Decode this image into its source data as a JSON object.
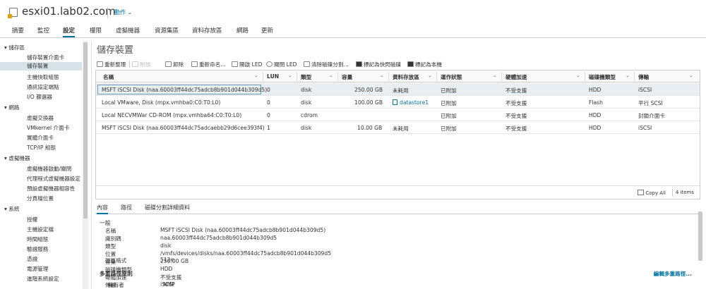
{
  "header": {
    "host": "esxi01.lab02.com",
    "actions": "動作 ⌄"
  },
  "tabs": [
    "摘要",
    "監控",
    "設定",
    "權限",
    "虛擬機器",
    "資源集區",
    "資料存放區",
    "網路",
    "更新"
  ],
  "sidebar": [
    {
      "label": "▾ 儲存區",
      "kind": "group"
    },
    {
      "label": "儲存裝置介面卡",
      "kind": "item"
    },
    {
      "label": "儲存裝置",
      "kind": "item",
      "selected": true
    },
    {
      "label": "主機快取組態",
      "kind": "item"
    },
    {
      "label": "通訊協定端點",
      "kind": "item"
    },
    {
      "label": "I/O 篩選器",
      "kind": "item"
    },
    {
      "label": "▾ 網路",
      "kind": "group"
    },
    {
      "label": "虛擬交換器",
      "kind": "item"
    },
    {
      "label": "VMkernel 介面卡",
      "kind": "item"
    },
    {
      "label": "實體介面卡",
      "kind": "item"
    },
    {
      "label": "TCP/IP 組態",
      "kind": "item"
    },
    {
      "label": "▾ 虛擬機器",
      "kind": "group"
    },
    {
      "label": "虛擬機器啟動/關閉",
      "kind": "item"
    },
    {
      "label": "代理程式虛擬機器設定",
      "kind": "item"
    },
    {
      "label": "預設虛擬機器相容性",
      "kind": "item"
    },
    {
      "label": "分頁檔位置",
      "kind": "item"
    },
    {
      "label": "▾ 系統",
      "kind": "group"
    },
    {
      "label": "授權",
      "kind": "item"
    },
    {
      "label": "主機設定檔",
      "kind": "item"
    },
    {
      "label": "時間組態",
      "kind": "item"
    },
    {
      "label": "驗證服務",
      "kind": "item"
    },
    {
      "label": "憑證",
      "kind": "item"
    },
    {
      "label": "電源管理",
      "kind": "item"
    },
    {
      "label": "進階系統設定",
      "kind": "item"
    }
  ],
  "page_title": "儲存裝置",
  "toolbar": {
    "refresh": "重新整理",
    "attach": "附加",
    "detach": "卸除",
    "rename": "重新命名...",
    "led_on": "開啟 LED",
    "led_off": "關閉 LED",
    "erase": "清除磁碟分割...",
    "mark_flash": "標記為快閃磁碟",
    "mark_local": "標記為本機"
  },
  "columns": [
    "名稱",
    "LUN",
    "類型",
    "容量",
    "資料存放區",
    "運作狀態",
    "硬體加速",
    "磁碟機類型",
    "傳輸"
  ],
  "rows": [
    {
      "name": "MSFT iSCSI Disk (naa.60003ff44dc75adcb8b901d044b309d5)",
      "lun": "0",
      "type": "disk",
      "capacity": "250.00 GB",
      "datastore": "未耗用",
      "status": "已附加",
      "hw": "不受支援",
      "drive": "HDD",
      "transport": "iSCSI"
    },
    {
      "name": "Local VMware, Disk (mpx.vmhba0:C0:T0:L0)",
      "lun": "0",
      "type": "disk",
      "capacity": "100.00 GB",
      "datastore": "datastore1",
      "status": "已附加",
      "hw": "不受支援",
      "drive": "Flash",
      "transport": "平行 SCSI"
    },
    {
      "name": "Local NECVMWar CD-ROM (mpx.vmhba64:C0:T0:L0)",
      "lun": "0",
      "type": "cdrom",
      "capacity": "",
      "datastore": "",
      "status": "已附加",
      "hw": "不受支援",
      "drive": "HDD",
      "transport": "封鎖介面卡"
    },
    {
      "name": "MSFT iSCSI Disk (naa.60003ff44dc75adcaebb29d6cee393f4)",
      "lun": "1",
      "type": "disk",
      "capacity": "10.00 GB",
      "datastore": "未耗用",
      "status": "已附加",
      "hw": "不受支援",
      "drive": "HDD",
      "transport": "iSCSI"
    }
  ],
  "footer": {
    "copy": "Copy All",
    "count": "4 items"
  },
  "detail_tabs": [
    "內容",
    "路徑",
    "磁碟分割詳細資料"
  ],
  "details": {
    "section": "一般",
    "fields": [
      {
        "k": "名稱",
        "v": "MSFT iSCSI Disk (naa.60003ff44dc75adcb8b901d044b309d5)"
      },
      {
        "k": "識別碼",
        "v": "naa.60003ff44dc75adcb8b901d044b309d5"
      },
      {
        "k": "類型",
        "v": "disk"
      },
      {
        "k": "位置",
        "v": "/vmfs/devices/disks/naa.60003ff44dc75adcb8b901d044b309d5"
      },
      {
        "k": "容量",
        "v": "250.00 GB"
      },
      {
        "k": "磁碟機類型",
        "v": "HDD"
      },
      {
        "k": "硬體加速",
        "v": "不受支援"
      },
      {
        "k": "傳輸",
        "v": "iSCSI"
      },
      {
        "k": "擁有者",
        "v": "NMP"
      },
      {
        "k": "磁區格式",
        "v": "512e"
      }
    ],
    "multipath": "多重路徑原則",
    "edit_multipath": "編輯多重路徑..."
  }
}
